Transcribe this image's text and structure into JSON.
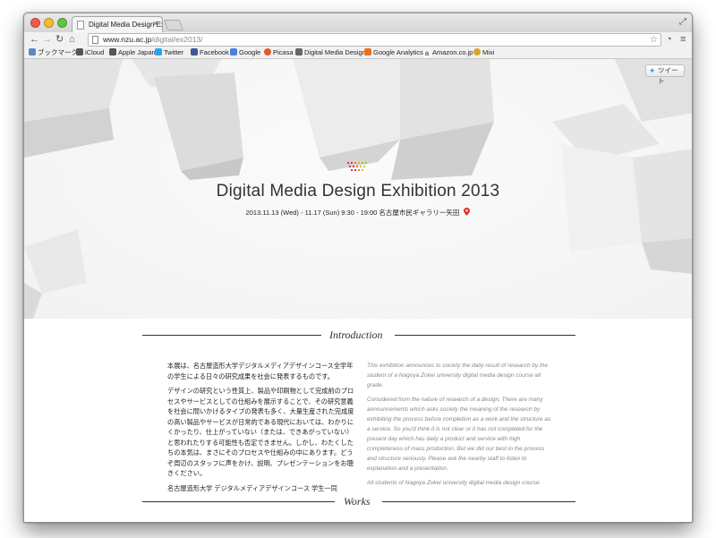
{
  "browser": {
    "tab_title": "Digital Media Design Exhib",
    "url_host": "www.nzu.ac.jp",
    "url_path": "/digital/ex2013/",
    "bookmarks": [
      {
        "label": "ブックマーク",
        "icon": "folder-icon",
        "color": "#5b87c8"
      },
      {
        "label": "iCloud",
        "icon": "apple-icon",
        "color": "#555555"
      },
      {
        "label": "Apple Japan",
        "icon": "apple-icon",
        "color": "#555555"
      },
      {
        "label": "Twitter",
        "icon": "twitter-icon",
        "color": "#2aa3ef"
      },
      {
        "label": "Facebook",
        "icon": "facebook-icon",
        "color": "#3b5998"
      },
      {
        "label": "Google",
        "icon": "google-icon",
        "color": "#4a7fe0"
      },
      {
        "label": "Picasa",
        "icon": "picasa-icon",
        "color": "#e05a2b"
      },
      {
        "label": "Digital Media Design",
        "icon": "dmd-icon",
        "color": "#666666"
      },
      {
        "label": "Google Analytics",
        "icon": "analytics-icon",
        "color": "#e8711b"
      },
      {
        "label": "Amazon.co.jp",
        "icon": "amazon-icon",
        "color": "#222222"
      },
      {
        "label": "Mixi",
        "icon": "mixi-icon",
        "color": "#d8a526"
      }
    ]
  },
  "page": {
    "tweet_label": "ツイート",
    "title": "Digital Media Design Exhibition 2013",
    "subtitle": "2013.11.13 (Wed) - 11.17 (Sun) 9:30 - 19:00  名古屋市民ギャラリー矢田",
    "accent_color": "#e0312f",
    "intro_heading": "Introduction",
    "works_heading": "Works",
    "intro_ja": [
      "本展は、名古屋造形大学デジタルメディアデザインコース全学年の学生による日々の研究成果を社会に発表するものです。",
      "デザインの研究という性質上、製品や印刷物として完成前のプロセスやサービスとしての仕組みを展示することで、その研究意義を社会に問いかけるタイプの発表も多く、大量生産された完成度の高い製品やサービスが日常的である現代においては、わかりにくかったり、仕上がっていない（または、できあがっていない）と思われたりする可能性も否定できません。しかし、わたくしたちの本気は、まさにそのプロセスや仕組みの中にあります。どうぞ周辺のスタッフに声をかけ、説明、プレゼンテーションをお聴きください。",
      "名古屋造形大学 デジタルメディアデザインコース 学生一同"
    ],
    "intro_en": [
      "This exhibition announces to society the daily result of research by the student of a Nagoya Zokei university digital media design course all grade.",
      "Considered from the nature of research of a design, There are many announcements which asks society the meaning of the research by exhibiting the process before completion as a work and the structure as a service. So you'd think it is not clear or it has not completed for the present day which has daily a product and service with high completeness of mass production. But we did our best in the process and structure seriously.   Please ask the nearby staff to listen to explanation and a presentation.",
      "All students of Nagoya Zokei university digital media design course."
    ]
  }
}
